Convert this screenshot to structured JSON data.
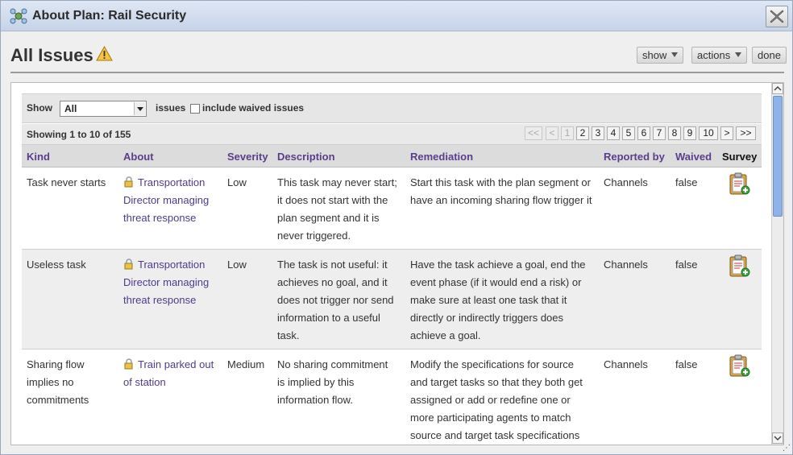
{
  "window": {
    "title": "About Plan: Rail Security"
  },
  "header": {
    "title": "All Issues",
    "show_label": "show",
    "actions_label": "actions",
    "done_label": "done"
  },
  "filter": {
    "show_label": "Show",
    "select_value": "All",
    "issues_label": "issues",
    "waived_label": "include waived issues"
  },
  "pager": {
    "summary": "Showing 1 to 10 of 155",
    "first": "<<",
    "prev": "<",
    "pages": [
      "1",
      "2",
      "3",
      "4",
      "5",
      "6",
      "7",
      "8",
      "9",
      "10"
    ],
    "next": ">",
    "last": ">>"
  },
  "columns": [
    "Kind",
    "About",
    "Severity",
    "Description",
    "Remediation",
    "Reported by",
    "Waived",
    "Survey"
  ],
  "rows": [
    {
      "kind": "Task never starts",
      "about": "Transportation Director managing threat response",
      "severity": "Low",
      "description": "This task may never start; it does not start with the plan segment and it is never triggered.",
      "remediation": "Start this task with the plan segment or have an incoming sharing flow trigger it",
      "reported_by": "Channels",
      "waived": "false"
    },
    {
      "kind": "Useless task",
      "about": "Transportation Director managing threat response",
      "severity": "Low",
      "description": "The task is not useful: it achieves no goal, and it does not trigger nor send information to a useful task.",
      "remediation": "Have the task achieve a goal, end the event phase (if it would end a risk) or make sure at least one task that it directly or indirectly triggers does achieve a goal.",
      "reported_by": "Channels",
      "waived": "false"
    },
    {
      "kind": "Sharing flow implies no commitments",
      "about": "Train parked out of station",
      "severity": "Medium",
      "description": "No sharing commitment is implied by this information flow.",
      "remediation": "Modify the specifications for source and target tasks so that they both get assigned or add or redefine one or more participating agents to match source and target task specifications",
      "reported_by": "Channels",
      "waived": "false"
    }
  ],
  "icons": {
    "app": "molecule-icon",
    "close": "close-icon",
    "warning": "warning-icon",
    "about": "lock-icon",
    "survey": "clipboard-add-icon"
  }
}
